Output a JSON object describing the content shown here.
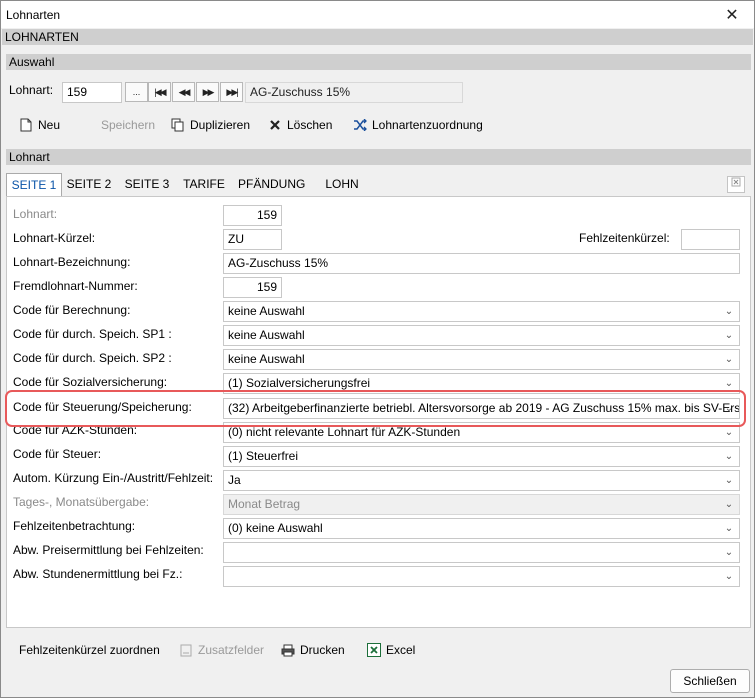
{
  "window": {
    "title": "Lohnarten",
    "close_glyph": "✕"
  },
  "header": {
    "section": "LOHNARTEN"
  },
  "auswahl": {
    "section": "Auswahl",
    "label": "Lohnart:",
    "value": "159",
    "browse": "...",
    "nav_first": "|◀◀",
    "nav_prev": "◀◀",
    "nav_next": "▶▶",
    "nav_last": "▶▶|",
    "name": "AG-Zuschuss 15%"
  },
  "toolbar": {
    "new": "Neu",
    "save": "Speichern",
    "duplicate": "Duplizieren",
    "delete": "Löschen",
    "mapping": "Lohnartenzuordnung"
  },
  "lohnart_section": "Lohnart",
  "tabs": [
    "SEITE 1",
    "SEITE 2",
    "SEITE 3",
    "TARIFE",
    "PFÄNDUNG",
    "LOHN"
  ],
  "form": {
    "lohnart_label": "Lohnart:",
    "lohnart_value": "159",
    "kuerzel_label": "Lohnart-Kürzel:",
    "kuerzel_value": "ZU",
    "fehlzeiten_kuerzel_label": "Fehlzeitenkürzel:",
    "fehlzeiten_kuerzel_value": "",
    "bezeichnung_label": "Lohnart-Bezeichnung:",
    "bezeichnung_value": "AG-Zuschuss 15%",
    "fremd_label": "Fremdlohnart-Nummer:",
    "fremd_value": "159",
    "rows": [
      {
        "label": "Code für Berechnung:",
        "value": "keine Auswahl"
      },
      {
        "label": "Code für durch. Speich. SP1 :",
        "value": "keine Auswahl"
      },
      {
        "label": "Code für durch. Speich. SP2 :",
        "value": "keine Auswahl"
      },
      {
        "label": "Code für Sozialversicherung:",
        "value": "(1) Sozialversicherungsfrei"
      },
      {
        "label": "Code für Steuerung/Speicherung:",
        "value": "(32) Arbeitgeberfinanzierte betriebl. Altersvorsorge ab 2019 - AG Zuschuss 15% max. bis SV-Ers"
      },
      {
        "label": "Code für AZK-Stunden:",
        "value": "(0) nicht relevante Lohnart für AZK-Stunden"
      },
      {
        "label": "Code für Steuer:",
        "value": "(1) Steuerfrei"
      },
      {
        "label": "Autom. Kürzung Ein-/Austritt/Fehlzeit:",
        "value": "Ja"
      },
      {
        "label": "Tages-, Monatsübergabe:",
        "value": "Monat Betrag"
      },
      {
        "label": "Fehlzeitenbetrachtung:",
        "value": "(0) keine Auswahl"
      },
      {
        "label": "Abw. Preisermittlung bei Fehlzeiten:",
        "value": ""
      },
      {
        "label": "Abw. Stundenermittlung bei Fz.:",
        "value": ""
      }
    ]
  },
  "footer": {
    "fehlzeiten": "Fehlzeitenkürzel zuordnen",
    "zusatz": "Zusatzfelder",
    "drucken": "Drucken",
    "excel": "Excel",
    "close": "Schließen"
  }
}
